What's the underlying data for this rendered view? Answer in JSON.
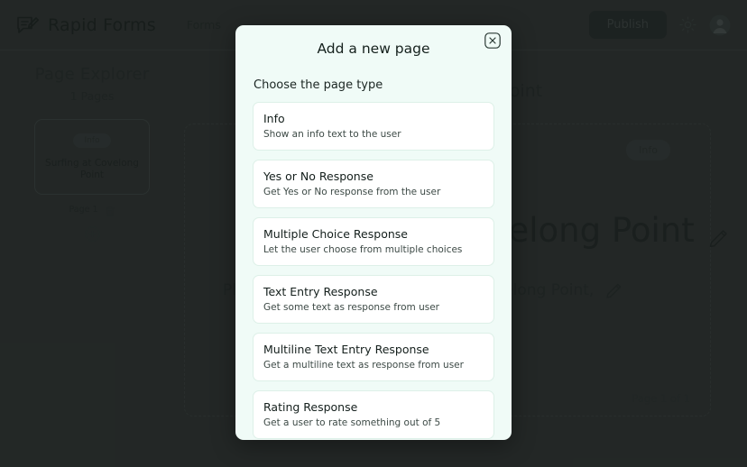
{
  "header": {
    "brand_name": "Rapid Forms",
    "brand_icon": "form-pencil-icon",
    "nav_link": "Forms",
    "publish_label": "Publish",
    "theme_icon": "sun-icon",
    "avatar_icon": "user-avatar"
  },
  "explorer": {
    "title": "Page Explorer",
    "count_label": "1 Pages",
    "page_card": {
      "badge": "Info",
      "text": "Surfing at Covelong Point"
    },
    "page_meta_label": "Page 1",
    "delete_icon": "trash-icon",
    "add_icon": "plus-circle-icon"
  },
  "canvas": {
    "title": "Surfing at Covelong Point",
    "badge": "Info",
    "heading": "Surfing at Covelong Point",
    "heading_edit_icon": "pencil-icon",
    "body": "Please share your experience at Covelong Point,",
    "body_edit_icon": "pencil-icon",
    "footer": "Page 1 of 1"
  },
  "modal": {
    "title": "Add a new page",
    "close_icon": "close-icon",
    "subtitle": "Choose the page type",
    "options": [
      {
        "title": "Info",
        "desc": "Show an info text to the user"
      },
      {
        "title": "Yes or No Response",
        "desc": "Get Yes or No response from the user"
      },
      {
        "title": "Multiple Choice Response",
        "desc": "Let the user choose from multiple choices"
      },
      {
        "title": "Text Entry Response",
        "desc": "Get some text as response from user"
      },
      {
        "title": "Multiline Text Entry Response",
        "desc": "Get a multiline text as response from user"
      },
      {
        "title": "Rating Response",
        "desc": "Get a user to rate something out of 5"
      }
    ]
  },
  "colors": {
    "app_background": "#2e3331",
    "modal_background": "#f0fbf7",
    "card_background": "#ffffff",
    "card_border": "#ddf0e8"
  }
}
